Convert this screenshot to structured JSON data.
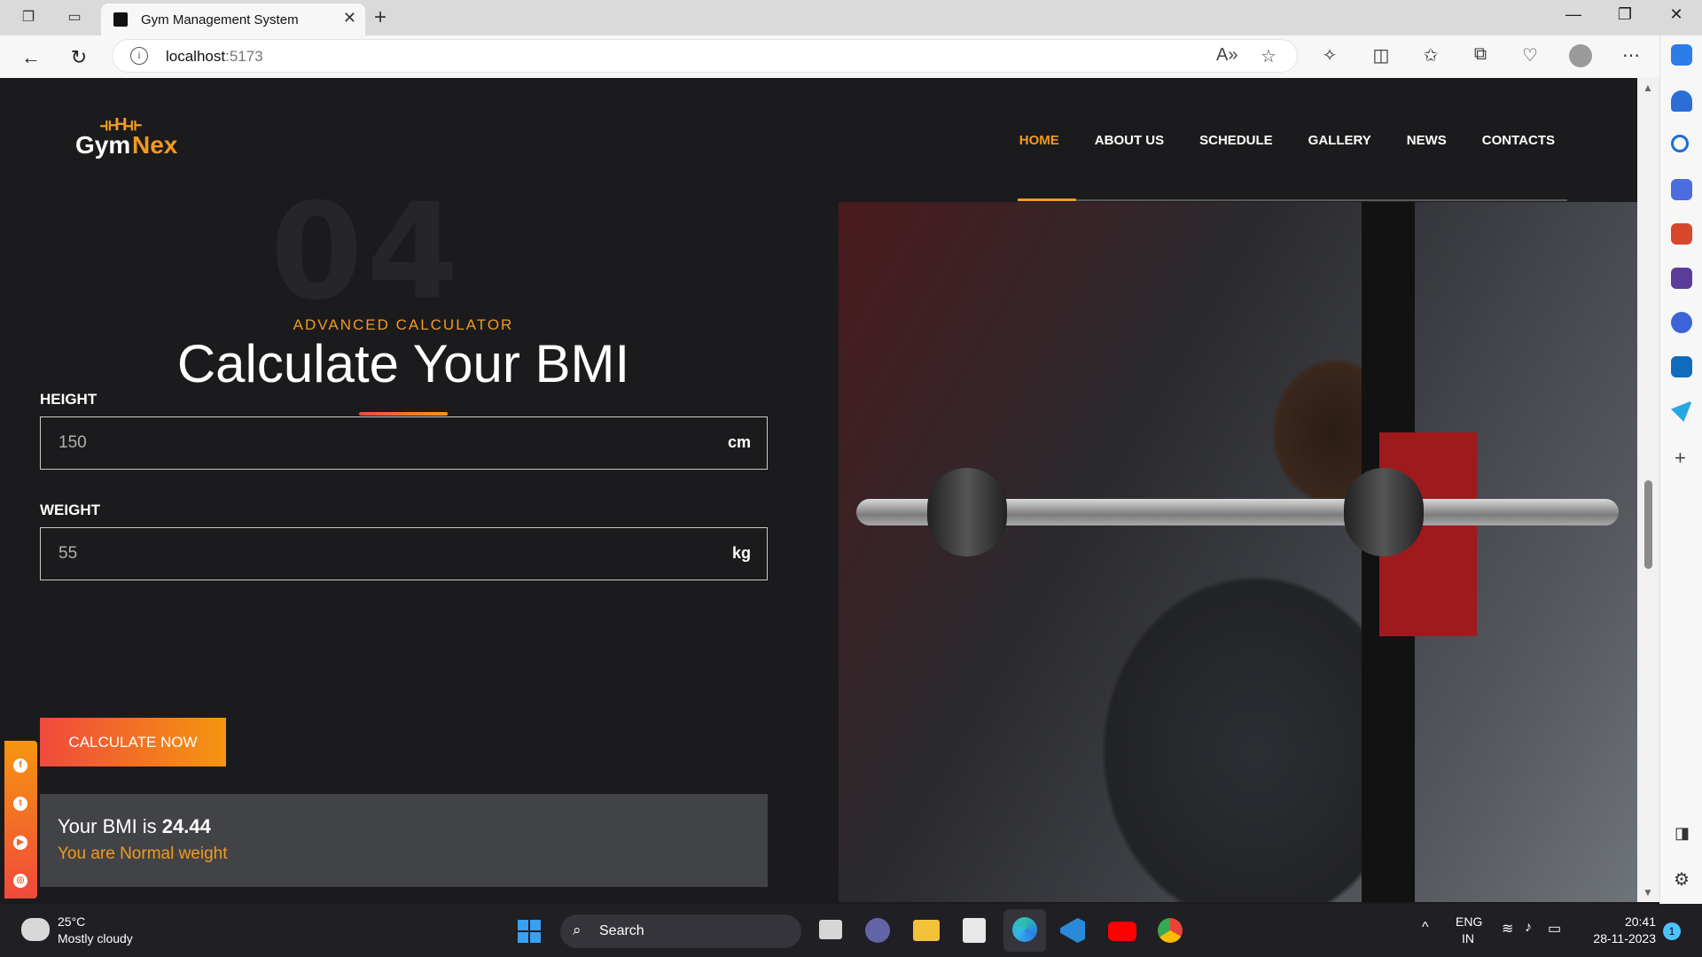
{
  "browser": {
    "tab_title": "Gym Management System",
    "url_host": "localhost",
    "url_port": ":5173"
  },
  "site": {
    "logo": {
      "gym": "Gym",
      "nex": "Nex",
      "mark": "⟛H⟛"
    },
    "nav": {
      "home": "HOME",
      "about": "ABOUT US",
      "schedule": "SCHEDULE",
      "gallery": "GALLERY",
      "news": "NEWS",
      "contacts": "CONTACTS"
    },
    "accent_color": "#f39a1e"
  },
  "bmi": {
    "bg_number": "04",
    "subtitle": "ADVANCED CALCULATOR",
    "title": "Calculate Your BMI",
    "height_label": "HEIGHT",
    "height_value": "150",
    "height_unit": "cm",
    "weight_label": "WEIGHT",
    "weight_value": "55",
    "weight_unit": "kg",
    "button_label": "CALCULATE NOW",
    "result_prefix": "Your BMI is ",
    "result_value": "24.44",
    "result_status": "You are Normal weight"
  },
  "taskbar": {
    "temp": "25°C",
    "weather": "Mostly cloudy",
    "search": "Search",
    "lang_1": "ENG",
    "lang_2": "IN",
    "time": "20:41",
    "date": "28-11-2023",
    "notif_count": "1"
  }
}
